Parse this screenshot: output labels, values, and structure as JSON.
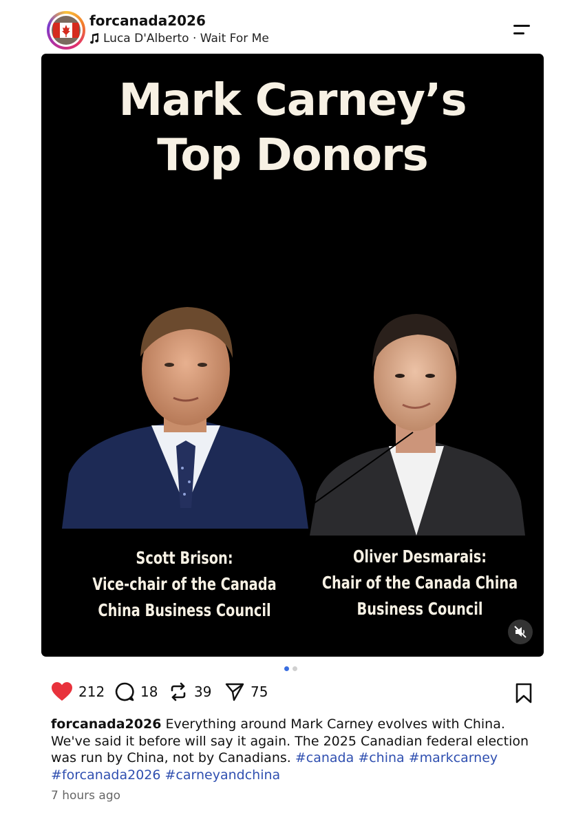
{
  "header": {
    "username": "forcanada2026",
    "music_artist_track": "Luca D'Alberto · Wait For Me",
    "avatar_icon": "canada-flag-avatar",
    "menu_icon": "menu-icon"
  },
  "media": {
    "title_line1": "Mark Carney’s",
    "title_line2": "Top Donors",
    "left_person": {
      "line1": "Scott Brison:",
      "line2": "Vice-chair of the Canada",
      "line3": "China Business Council"
    },
    "right_person": {
      "line1": "Oliver Desmarais:",
      "line2": "Chair of the Canada China",
      "line3": "Business Council"
    },
    "mute_icon": "muted-speaker-icon",
    "carousel": {
      "count": 2,
      "active_index": 0
    }
  },
  "actions": {
    "likes": "212",
    "comments": "18",
    "reposts": "39",
    "shares": "75"
  },
  "caption": {
    "username": "forcanada2026",
    "text": " Everything around Mark Carney evolves with China. We've said it before will say it again. The 2025 Canadian federal election was run by China, not by Canadians.  ",
    "hashtags": [
      "#canada",
      "#china",
      "#markcarney",
      "#forcanada2026",
      "#carneyandchina"
    ]
  },
  "timestamp": "7 hours ago",
  "colors": {
    "like_red": "#e8323c",
    "hashtag_blue": "#2f4fb0",
    "dot_active": "#3a6ee0",
    "title_cream": "#f7f1e4"
  }
}
